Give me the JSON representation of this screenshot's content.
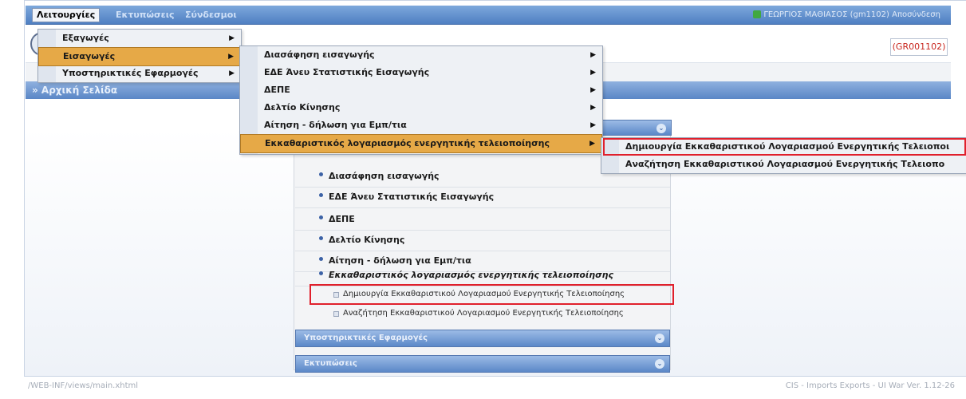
{
  "menubar": {
    "items": [
      "Λειτουργίες",
      "Εκτυπώσεις",
      "Σύνδεσμοι"
    ],
    "user": "ΓΕΩΡΓΙΟΣ ΜΑΘΙΑΣΟΣ (gm1102) Αποσύνδεση"
  },
  "header": {
    "gr_code": "(GR001102)"
  },
  "home": {
    "label": "» Αρχική Σελίδα"
  },
  "menu1": {
    "items": [
      "Εξαγωγές",
      "Εισαγωγές",
      "Υποστηρικτικές Εφαρμογές"
    ]
  },
  "menu2": {
    "items": [
      "Διασάφηση εισαγωγής",
      "ΕΔΕ Άνευ Στατιστικής Εισαγωγής",
      "ΔΕΠΕ",
      "Δελτίο Κίνησης",
      "Αίτηση - δήλωση για Εμπ/τια",
      "Εκκαθαριστικός λογαριασμός ενεργητικής τελειοποίησης"
    ]
  },
  "menu3": {
    "items": [
      "Δημιουργία Εκκαθαριστικού Λογαριασμού Ενεργητικής Τελειοποι",
      "Αναζήτηση Εκκαθαριστικού Λογαριασμού Ενεργητικής Τελειοπο"
    ]
  },
  "panel": {
    "rows": [
      "Διασάφηση εισαγωγής",
      "ΕΔΕ Άνευ Στατιστικής Εισαγωγής",
      "ΔΕΠΕ",
      "Δελτίο Κίνησης",
      "Αίτηση - δήλωση για Εμπ/τια",
      "Εκκαθαριστικός λογαριασμός ενεργητικής τελειοποίησης"
    ],
    "sub_rows": [
      "Δημιουργία Εκκαθαριστικού Λογαριασμού Ενεργητικής Τελειοποίησης",
      "Αναζήτηση Εκκαθαριστικού Λογαριασμού Ενεργητικής Τελειοποίησης"
    ],
    "sections": [
      "Υποστηρικτικές Εφαρμογές",
      "Εκτυπώσεις"
    ]
  },
  "footer": {
    "left": "/WEB-INF/views/main.xhtml",
    "right": "CIS - Imports Exports - UI War Ver. 1.12-26"
  },
  "colors": {
    "highlight": "#e6a947",
    "red_box": "#e0202c",
    "menubar": "#5a86c6"
  }
}
